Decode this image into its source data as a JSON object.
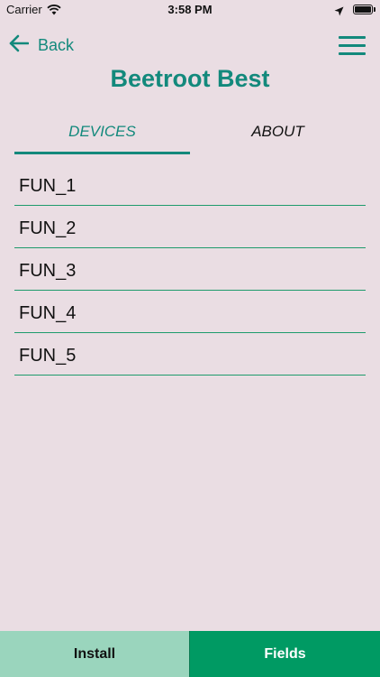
{
  "status_bar": {
    "carrier": "Carrier",
    "time": "3:58 PM"
  },
  "nav": {
    "back_label": "Back",
    "title": "Beetroot Best",
    "back_icon": "arrow-left-icon",
    "menu_icon": "hamburger-menu-icon"
  },
  "tabs": [
    {
      "label": "DEVICES",
      "active": true
    },
    {
      "label": "ABOUT",
      "active": false
    }
  ],
  "devices": [
    {
      "label": "FUN_1"
    },
    {
      "label": "FUN_2"
    },
    {
      "label": "FUN_3"
    },
    {
      "label": "FUN_4"
    },
    {
      "label": "FUN_5"
    }
  ],
  "bottom_bar": {
    "install_label": "Install",
    "fields_label": "Fields"
  },
  "colors": {
    "accent": "#13897c",
    "background": "#eadde3",
    "install_bg": "#9ad5bd",
    "fields_bg": "#009a63",
    "divider": "#1e9b6c"
  }
}
